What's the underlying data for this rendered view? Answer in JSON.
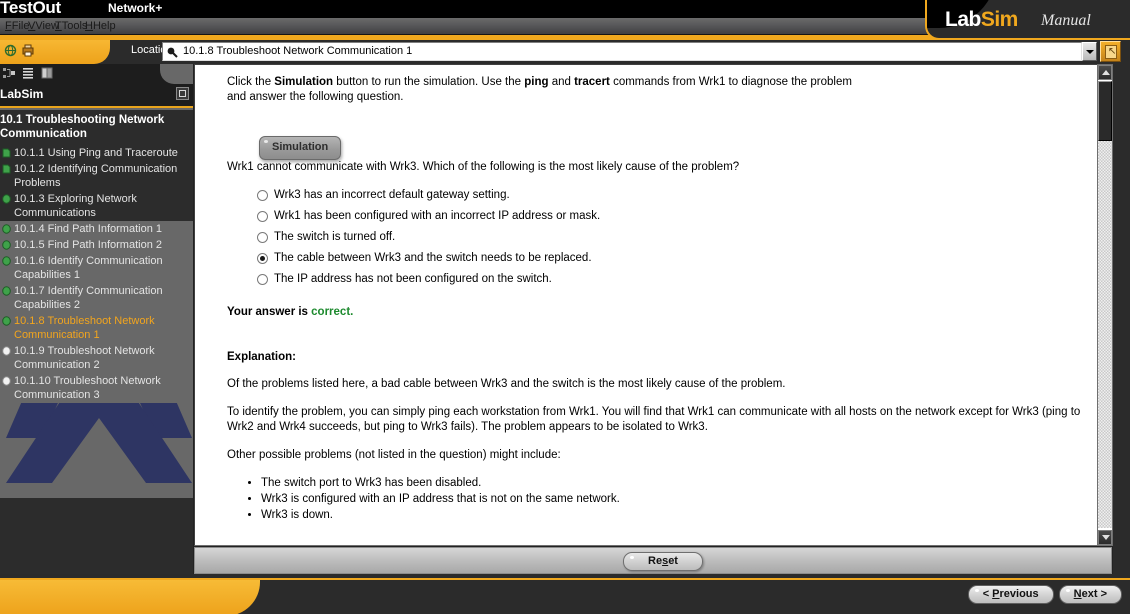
{
  "window": {
    "brand": "TestOut",
    "course_title": "Network+",
    "controls": [
      {
        "name": "minimize",
        "glyph": "–"
      },
      {
        "name": "maximize",
        "glyph": "❐"
      },
      {
        "name": "close",
        "glyph": "✕"
      }
    ]
  },
  "menu": {
    "items": [
      {
        "label": "File",
        "accel": "F"
      },
      {
        "label": "View",
        "accel": "V"
      },
      {
        "label": "Tools",
        "accel": "T"
      },
      {
        "label": "Help",
        "accel": "H"
      }
    ]
  },
  "logo": {
    "lab": "Lab",
    "sim": "Sim",
    "manual": "Manual"
  },
  "location": {
    "label": "Location:",
    "value": "10.1.8 Troubleshoot Network Communication 1",
    "placeholder": "Location",
    "go_title": "Go"
  },
  "sidebar": {
    "title": "LabSim",
    "toolbar_icons": [
      "tree-view-icon",
      "list-view-icon",
      "book-icon"
    ],
    "section": "10.1 Troubleshooting Network Communication",
    "items": [
      {
        "label": "10.1.1 Using Ping and Traceroute",
        "state": "visited",
        "shade": "dark"
      },
      {
        "label": "10.1.2 Identifying Communication Problems",
        "state": "visited",
        "shade": "dark"
      },
      {
        "label": "10.1.3 Exploring Network Communications",
        "state": "visited",
        "shade": "dark"
      },
      {
        "label": "10.1.4 Find Path Information 1",
        "state": "visited",
        "shade": "light"
      },
      {
        "label": "10.1.5 Find Path Information 2",
        "state": "visited",
        "shade": "light"
      },
      {
        "label": "10.1.6 Identify Communication Capabilities 1",
        "state": "visited",
        "shade": "light"
      },
      {
        "label": "10.1.7 Identify Communication Capabilities 2",
        "state": "visited",
        "shade": "light"
      },
      {
        "label": "10.1.8 Troubleshoot Network Communication 1",
        "state": "current",
        "shade": "light"
      },
      {
        "label": "10.1.9 Troubleshoot Network Communication 2",
        "state": "unvisited",
        "shade": "light"
      },
      {
        "label": "10.1.10 Troubleshoot Network Communication 3",
        "state": "unvisited",
        "shade": "light"
      }
    ]
  },
  "content": {
    "intro_parts": [
      "Click the ",
      "Simulation",
      " button to run the simulation. Use the ",
      "ping",
      " and ",
      "tracert",
      " commands from Wrk1 to diagnose the problem and answer the following question."
    ],
    "simulation_button": "Simulation",
    "question": "Wrk1 cannot communicate with Wrk3. Which of the following is the most likely cause of the problem?",
    "options": [
      {
        "label": "Wrk3 has an incorrect default gateway setting.",
        "selected": false
      },
      {
        "label": "Wrk1 has been configured with an incorrect IP address or mask.",
        "selected": false
      },
      {
        "label": "The switch is turned off.",
        "selected": false
      },
      {
        "label": "The cable between Wrk3 and the switch needs to be replaced.",
        "selected": true
      },
      {
        "label": "The IP address has not been configured on the switch.",
        "selected": false
      }
    ],
    "answer_prefix": "Your answer is ",
    "answer_result": "correct.",
    "answer_color": "#1d8a2e",
    "explanation_heading": "Explanation:",
    "explanation_paragraphs": [
      "Of the problems listed here, a bad cable between Wrk3 and the switch is the most likely cause of the problem.",
      "To identify the problem, you can simply ping each workstation from Wrk1. You will find that Wrk1 can communicate with all hosts on the network except for Wrk3 (ping to Wrk2 and Wrk4 succeeds, but ping to Wrk3 fails). The problem appears to be isolated to Wrk3.",
      "Other possible problems (not listed in the question) might include:"
    ],
    "other_problems": [
      "The switch port to Wrk3 has been disabled.",
      "Wrk3 is configured with an IP address that is not on the same network.",
      "Wrk3 is down."
    ]
  },
  "toolbar": {
    "reset_label": "Reset",
    "reset_accel": "s"
  },
  "footer": {
    "previous_label": "< Previous",
    "previous_accel": "P",
    "next_label": "Next >",
    "next_accel": "N"
  },
  "colors": {
    "accent_orange": "#f0a81e",
    "sidebar_dark": "#2c2c2c",
    "sidebar_light": "#686868",
    "current_item": "#f2a51e",
    "correct_green": "#1d8a2e"
  }
}
